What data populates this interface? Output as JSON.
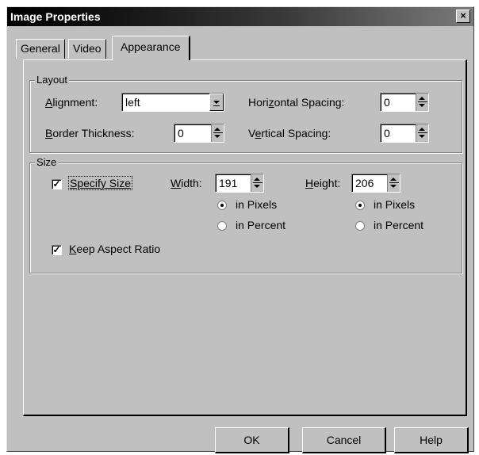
{
  "window": {
    "title": "Image Properties",
    "close_glyph": "×"
  },
  "tabs": [
    {
      "label": "General"
    },
    {
      "label": "Video"
    },
    {
      "label": "Appearance"
    }
  ],
  "layout": {
    "group_label": "Layout",
    "alignment_label_accel": "A",
    "alignment_label_rest": "lignment:",
    "alignment_value": "left",
    "border_label_accel": "B",
    "border_label_rest": "order Thickness:",
    "border_value": "0",
    "hspacing_label_pre": "Hori",
    "hspacing_label_accel": "z",
    "hspacing_label_post": "ontal Spacing:",
    "hspacing_value": "0",
    "vspacing_label_pre": "V",
    "vspacing_label_accel": "e",
    "vspacing_label_post": "rtical Spacing:",
    "vspacing_value": "0"
  },
  "size": {
    "group_label": "Size",
    "specify_size_label": "Specify Size",
    "specify_size_checked": true,
    "width_label_accel": "W",
    "width_label_rest": "idth:",
    "width_value": "191",
    "height_label_accel": "H",
    "height_label_rest": "eight:",
    "height_value": "206",
    "width_unit_pixels": "in Pixels",
    "width_unit_percent": "in Percent",
    "height_unit_pixels": "in Pixels",
    "height_unit_percent": "in Percent",
    "keep_aspect_label_accel": "K",
    "keep_aspect_label_rest": "eep Aspect Ratio",
    "keep_aspect_checked": true,
    "check_glyph": "✓"
  },
  "buttons": {
    "ok": "OK",
    "cancel": "Cancel",
    "help": "Help"
  }
}
